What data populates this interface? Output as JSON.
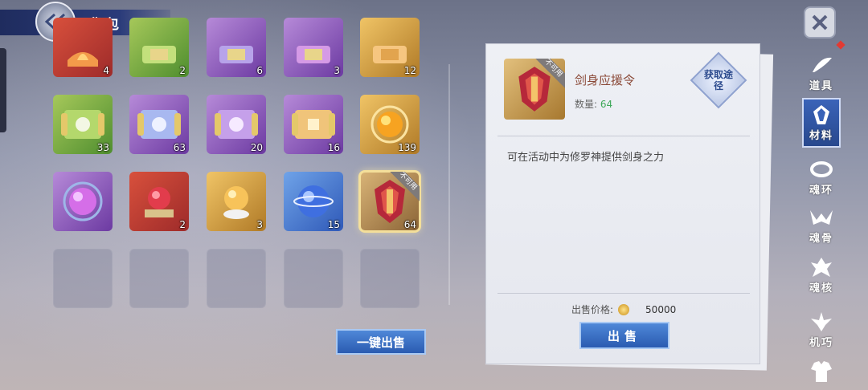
{
  "header": {
    "title": "背包"
  },
  "grid": {
    "row1_counts": [
      "4",
      "2",
      "6",
      "3",
      "12"
    ],
    "row2_counts": [
      "33",
      "63",
      "20",
      "16",
      "139"
    ],
    "row3_counts": [
      "",
      "2",
      "3",
      "15",
      "64"
    ],
    "unusable_tag": "不可用"
  },
  "sell_all_label": "一键出售",
  "detail": {
    "item_name": "剑身应援令",
    "quantity_label": "数量:",
    "quantity_value": "64",
    "obtain_label": "获取途径",
    "desc_pre": "可在",
    "desc_highlight": "",
    "desc_post": "活动中为修罗神提供剑身之力",
    "price_label": "出售价格:",
    "price_value": "50000",
    "sell_label": "出售"
  },
  "nav": {
    "items": [
      {
        "label": "道具"
      },
      {
        "label": "材料"
      },
      {
        "label": "魂环"
      },
      {
        "label": "魂骨"
      },
      {
        "label": "魂核"
      },
      {
        "label": "机巧"
      }
    ],
    "active": "材料"
  },
  "colors": {
    "accent_blue": "#2a5bb1",
    "highlight_green": "#3fbe7a",
    "item_name": "#8b4a38"
  }
}
